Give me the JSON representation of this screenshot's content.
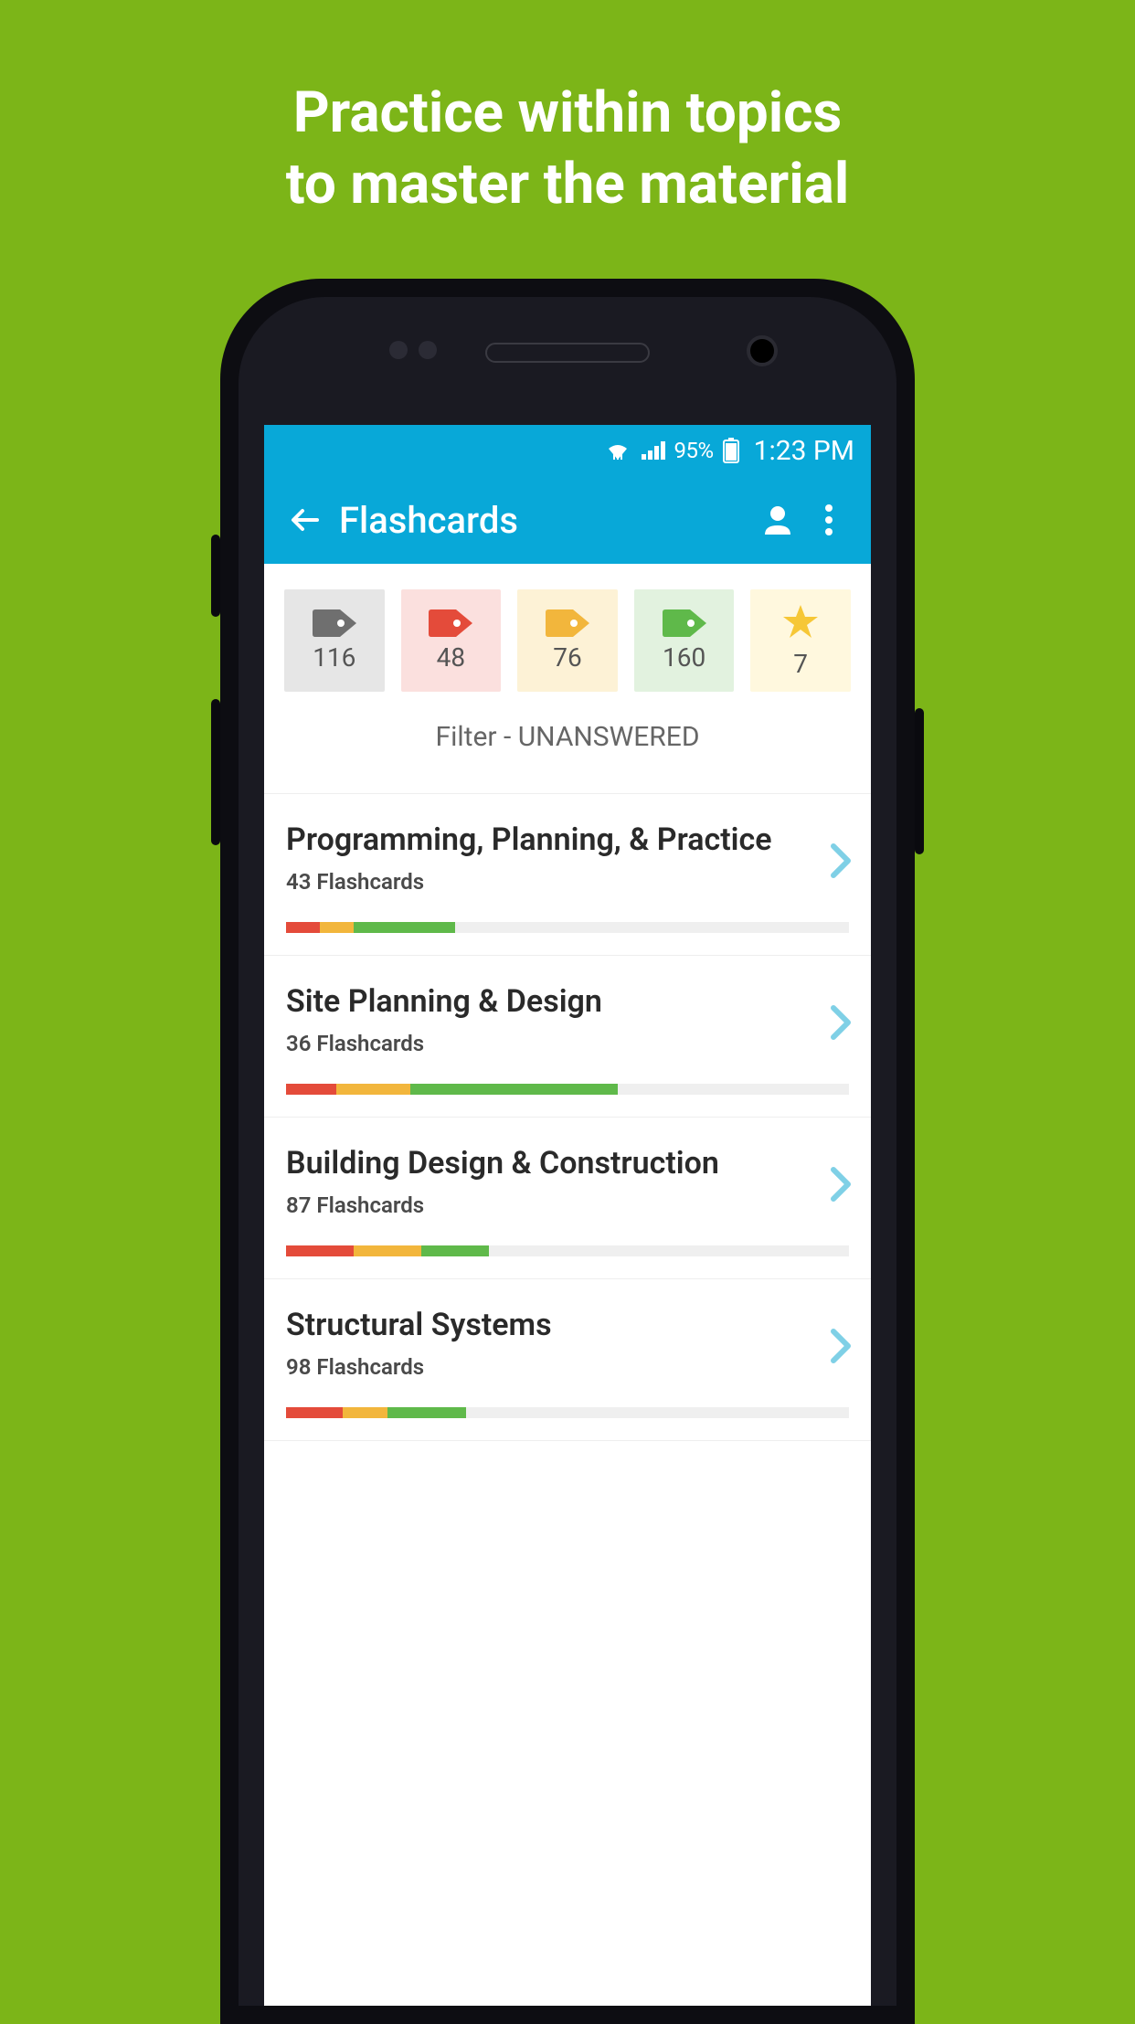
{
  "promo": {
    "line1": "Practice within topics",
    "line2": "to master the material"
  },
  "status": {
    "battery_pct": "95%",
    "time": "1:23 PM"
  },
  "appbar": {
    "title": "Flashcards"
  },
  "filterChips": {
    "gray": {
      "count": "116"
    },
    "red": {
      "count": "48"
    },
    "yellow": {
      "count": "76"
    },
    "green": {
      "count": "160"
    },
    "star": {
      "count": "7"
    }
  },
  "filterLabel": {
    "prefix": "Filter - ",
    "value": "UNANSWERED"
  },
  "topics": [
    {
      "title": "Programming, Planning, & Practice",
      "sub": "43 Flashcards",
      "red": 6,
      "yellow": 6,
      "green": 18
    },
    {
      "title": "Site Planning & Design",
      "sub": "36 Flashcards",
      "red": 9,
      "yellow": 13,
      "green": 37
    },
    {
      "title": "Building Design & Construction",
      "sub": "87 Flashcards",
      "red": 12,
      "yellow": 12,
      "green": 12
    },
    {
      "title": "Structural Systems",
      "sub": "98 Flashcards",
      "red": 10,
      "yellow": 8,
      "green": 14
    }
  ],
  "colors": {
    "accent": "#08a8d8",
    "bg": "#7cb518",
    "tagGray": "#6f6f6f",
    "tagRed": "#e44b3a",
    "tagYellow": "#f2b63c",
    "tagGreen": "#5fb94a",
    "star": "#f6c736",
    "chevron": "#7fd0e6"
  }
}
